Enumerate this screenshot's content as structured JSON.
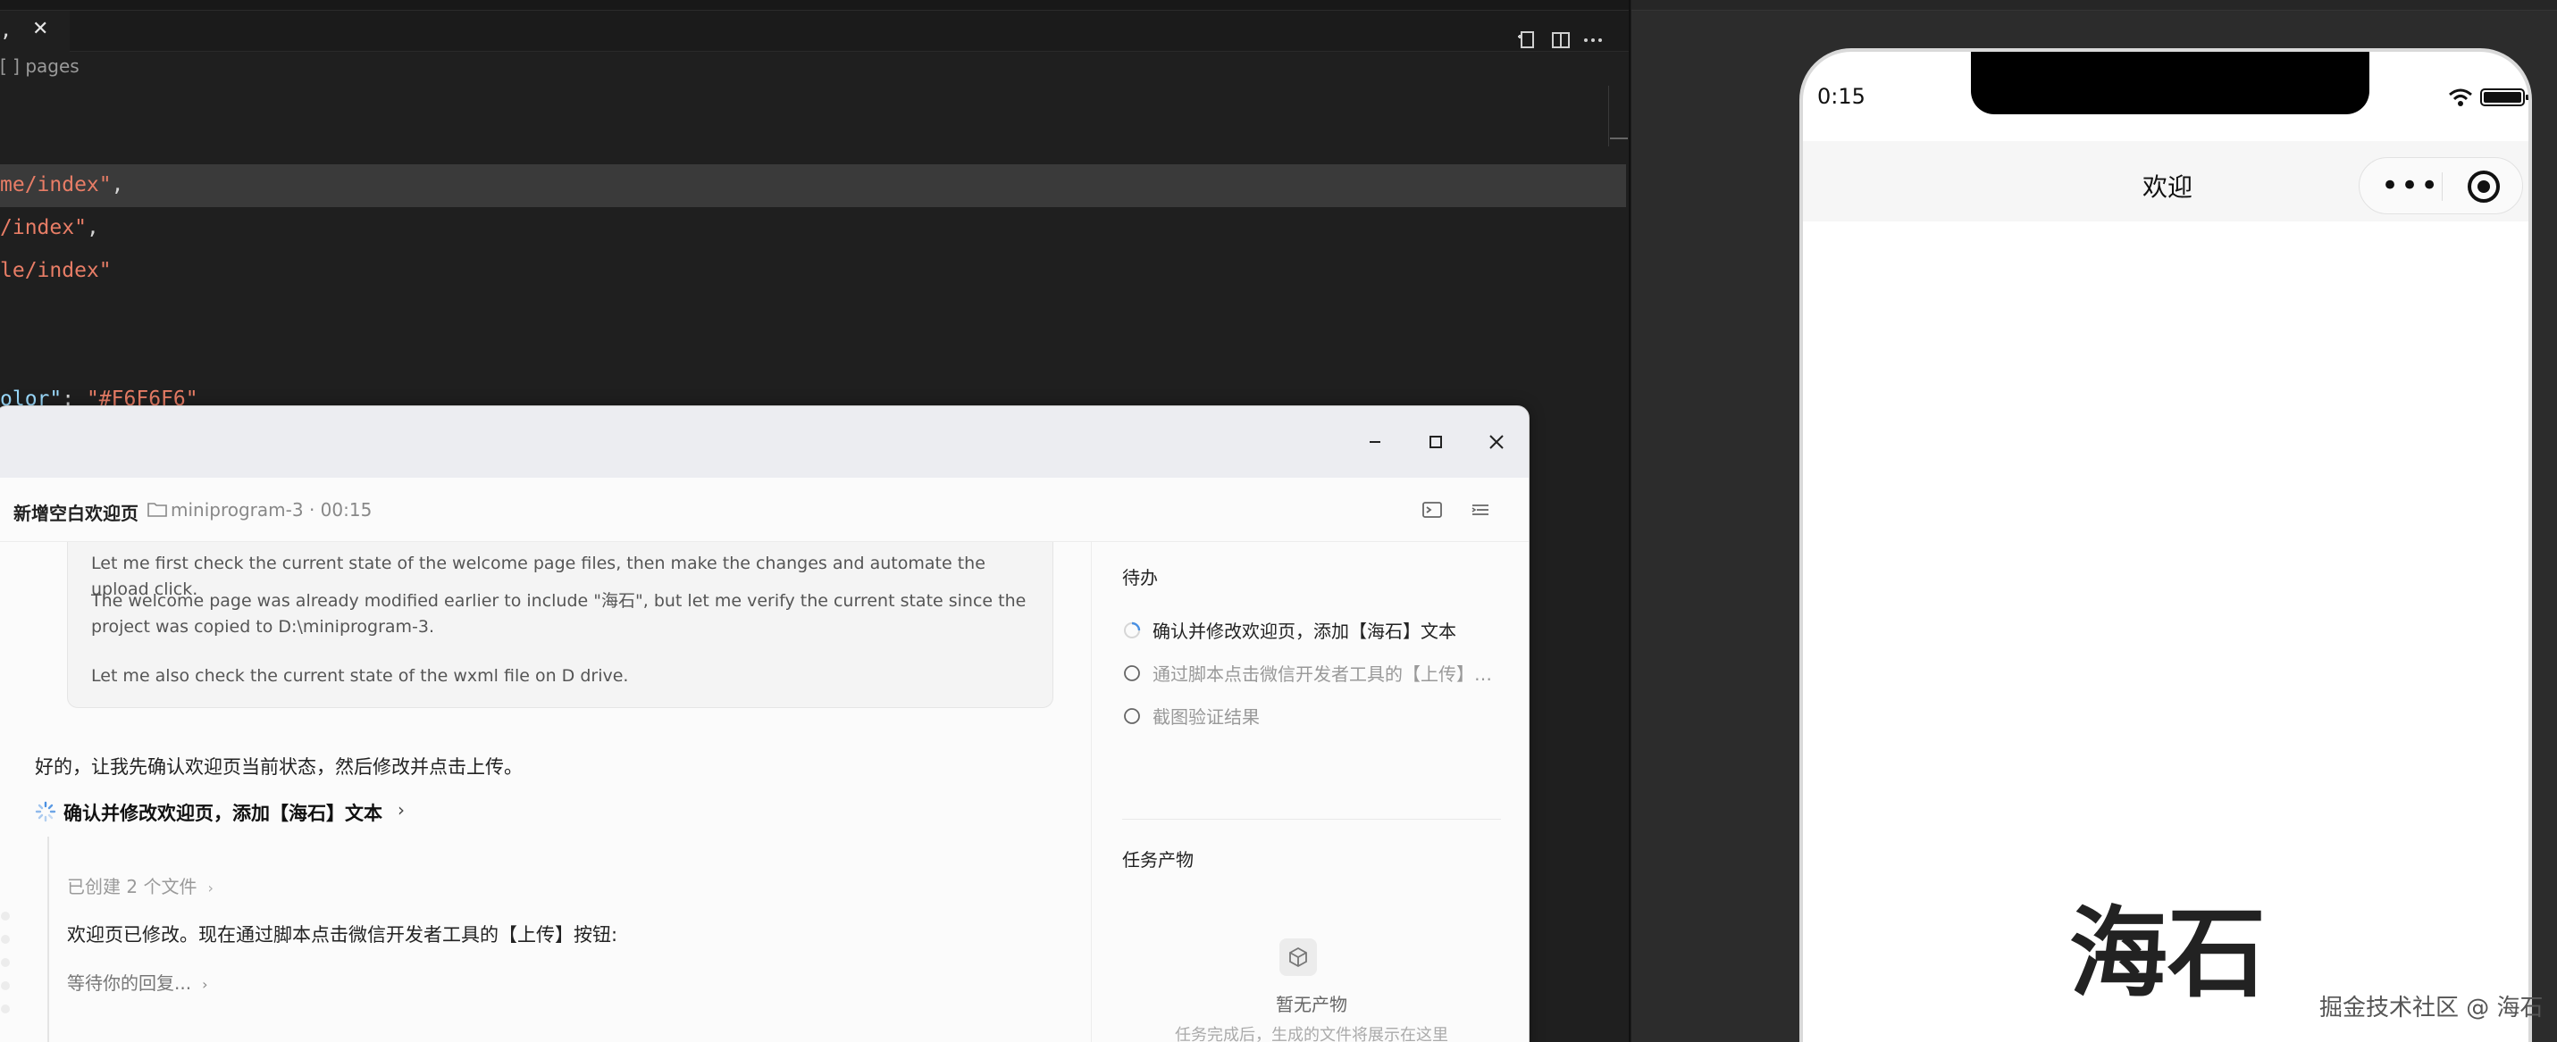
{
  "editor": {
    "tab_name": ",",
    "tab_close": "✕",
    "breadcrumb": "[ ] pages",
    "code_lines": [
      {
        "str": "me/index\"",
        "punc": ","
      },
      {
        "str": "/index\"",
        "punc": ","
      },
      {
        "str": "le/index\"",
        "punc": ""
      },
      {
        "key": "olor\"",
        "punc": ": ",
        "str2": "\"#F6F6F6\""
      }
    ]
  },
  "simulator": {
    "time": "0:15",
    "nav_title": "欢迎",
    "capsule_dots": "•••",
    "page_text": "海石",
    "watermark": "掘金技术社区 @ 海石"
  },
  "dialog": {
    "title": "新增空白欢迎页",
    "meta": "miniprogram-3 · 00:15",
    "thinking": [
      "Let me first check the current state of the welcome page files, then make the changes and automate the upload click.",
      "The welcome page was already modified earlier to include \"海石\", but let me verify the current state since the project was copied to D:\\miniprogram-3.",
      "Let me also check the current state of the wxml file on D drive."
    ],
    "reply": "好的，让我先确认欢迎页当前状态，然后修改并点击上传。",
    "task_label": "确认并修改欢迎页，添加【海石】文本",
    "task_chevron": "›",
    "created": "已创建 2 个文件",
    "modified": "欢迎页已修改。现在通过脚本点击微信开发者工具的【上传】按钮:",
    "waiting": "等待你的回复...",
    "todo_title": "待办",
    "todos": [
      {
        "text": "确认并修改欢迎页，添加【海石】文本",
        "status": "in-progress"
      },
      {
        "text": "通过脚本点击微信开发者工具的【上传】按钮",
        "status": "pending"
      },
      {
        "text": "截图验证结果",
        "status": "pending"
      }
    ],
    "artifacts_title": "任务产物",
    "empty_title": "暂无产物",
    "empty_sub": "任务完成后，生成的文件将展示在这里"
  },
  "colors": {
    "accent": "#4a90e2",
    "string": "#e87d66"
  }
}
